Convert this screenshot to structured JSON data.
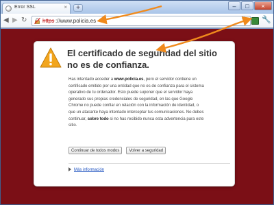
{
  "browser": {
    "tab": {
      "title": "Error SSL",
      "close_glyph": "×",
      "favicon": "globe-icon"
    },
    "new_tab_glyph": "+",
    "window_controls": {
      "minimize": "–",
      "maximize": "□",
      "close": "×"
    },
    "nav": {
      "back": "◀",
      "forward": "▶",
      "reload": "↻"
    },
    "omnibox": {
      "scheme": "https",
      "rest": "://www.policia.es",
      "lock_icon": "broken-lock-icon"
    },
    "star_glyph": "☆",
    "wrench_glyph": "🔧"
  },
  "interstitial": {
    "headline": "El certificado de seguridad del sitio no es de confianza.",
    "para1_a": "Has intentado acceder a ",
    "para1_site": "www.policia.es",
    "para1_b": ", pero el servidor contiene un certificado emitido por una entidad que no es de confianza para el sistema operativo de tu ordenador. Esto puede suponer que el servidor haya generado sus propias credenciales de seguridad, en las que Google Chrome no puede confiar en relación con la información de identidad, o que un atacante haya intentado interceptar tus comunicaciones. No debes continuar, ",
    "para1_strong": "sobre todo",
    "para1_c": " si no has recibido nunca esta advertencia para este sitio.",
    "proceed_button": "Continuar de todos modos",
    "back_button": "Volver a seguridad",
    "more_info": "Más información"
  },
  "colors": {
    "page_bg": "#7b0f16",
    "warning_triangle": "#f2a51d",
    "annotation_arrow": "#f08a1c"
  }
}
